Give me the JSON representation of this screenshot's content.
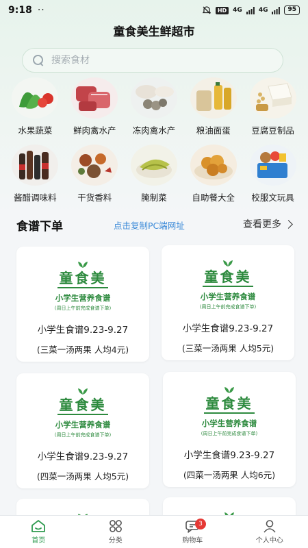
{
  "status_bar": {
    "time": "9:18",
    "dots": "··",
    "hd": "HD",
    "signal1": "4G",
    "signal2": "4G",
    "battery": "95"
  },
  "header": {
    "title": "童食美生鲜超市"
  },
  "search": {
    "placeholder": "搜索食材"
  },
  "categories": [
    {
      "label": "水果蔬菜",
      "icon": "fruit-veg-image"
    },
    {
      "label": "鲜肉禽水产",
      "icon": "fresh-meat-image"
    },
    {
      "label": "冻肉禽水产",
      "icon": "frozen-meat-image"
    },
    {
      "label": "粮油面蛋",
      "icon": "grain-oil-image"
    },
    {
      "label": "豆腐豆制品",
      "icon": "tofu-image"
    },
    {
      "label": "酱醋调味料",
      "icon": "sauce-image"
    },
    {
      "label": "干货香料",
      "icon": "spice-image"
    },
    {
      "label": "腌制菜",
      "icon": "pickle-image"
    },
    {
      "label": "自助餐大全",
      "icon": "buffet-image"
    },
    {
      "label": "校服文玩具",
      "icon": "uniform-toy-image"
    }
  ],
  "section": {
    "title": "食谱下单",
    "link": "点击复制PC端网址",
    "more": "查看更多"
  },
  "cards": [
    {
      "brand": "童食美",
      "sub": "小学生营养食谱",
      "tiny": "(周日上午前完成食谱下单)",
      "title": "小学生食谱9.23-9.27",
      "desc": "(三菜一汤两果 人均4元)"
    },
    {
      "brand": "童食美",
      "sub": "小学生营养食谱",
      "tiny": "(周日上午前完成食谱下单)",
      "title": "小学生食谱9.23-9.27",
      "desc": "(三菜一汤两果 人均5元)"
    },
    {
      "brand": "童食美",
      "sub": "小学生营养食谱",
      "tiny": "(周日上午前完成食谱下单)",
      "title": "小学生食谱9.23-9.27",
      "desc": "(四菜一汤两果 人均5元)"
    },
    {
      "brand": "童食美",
      "sub": "小学生营养食谱",
      "tiny": "(周日上午前完成食谱下单)",
      "title": "小学生食谱9.23-9.27",
      "desc": "(四菜一汤两果 人均6元)"
    }
  ],
  "tabbar": {
    "items": [
      {
        "label": "首页",
        "icon": "home-icon"
      },
      {
        "label": "分类",
        "icon": "category-icon"
      },
      {
        "label": "购物车",
        "icon": "cart-icon",
        "badge": "3"
      },
      {
        "label": "个人中心",
        "icon": "user-icon"
      }
    ]
  },
  "colors": {
    "accent": "#2e9a4f",
    "brand_green": "#2d8a3e",
    "link": "#3b8ad8",
    "badge": "#e53935"
  }
}
